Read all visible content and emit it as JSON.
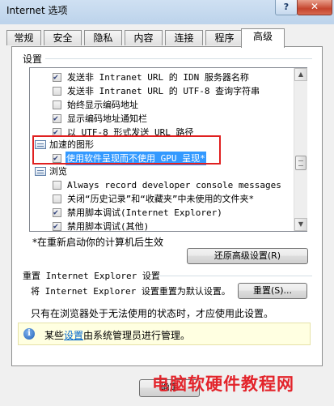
{
  "window": {
    "title": "Internet 选项",
    "help_label": "?",
    "close_label": "✕"
  },
  "tabs": [
    "常规",
    "安全",
    "隐私",
    "内容",
    "连接",
    "程序",
    "高级"
  ],
  "active_tab": "高级",
  "settings": {
    "group_label": "设置",
    "items": [
      {
        "type": "checkbox",
        "checked": true,
        "label": "发送非 Intranet URL 的 IDN 服务器名称"
      },
      {
        "type": "checkbox",
        "checked": false,
        "label": "发送非 Intranet URL 的 UTF-8 查询字符串"
      },
      {
        "type": "checkbox",
        "checked": false,
        "label": "始终显示编码地址"
      },
      {
        "type": "checkbox",
        "checked": true,
        "label": "显示编码地址通知栏"
      },
      {
        "type": "checkbox",
        "checked": true,
        "label": "以 UTF-8 形式发送 URL 路径"
      },
      {
        "type": "category",
        "label": "加速的图形"
      },
      {
        "type": "checkbox",
        "checked": true,
        "label": "使用软件呈现而不使用 GPU 呈现*",
        "selected": true
      },
      {
        "type": "category",
        "label": "浏览"
      },
      {
        "type": "checkbox",
        "checked": false,
        "label": "Always record developer console messages"
      },
      {
        "type": "checkbox",
        "checked": false,
        "label": "关闭“历史记录”和“收藏夹”中未使用的文件夹*"
      },
      {
        "type": "checkbox",
        "checked": true,
        "label": "禁用脚本调试(Internet Explorer)"
      },
      {
        "type": "checkbox",
        "checked": true,
        "label": "禁用脚本调试(其他)"
      }
    ],
    "restart_note": "*在重新启动你的计算机后生效",
    "restore_button": "还原高级设置(R)"
  },
  "reset": {
    "group_label": "重置 Internet Explorer 设置",
    "description": "将 Internet Explorer 设置重置为默认设置。",
    "button": "重置(S)...",
    "note": "只有在浏览器处于无法使用的状态时，才应使用此设置。"
  },
  "info": {
    "prefix": "某些",
    "link": "设置",
    "suffix": "由系统管理员进行管理。"
  },
  "footer": {
    "ok_button": "确定"
  },
  "watermark": "电脑软硬件教程网"
}
